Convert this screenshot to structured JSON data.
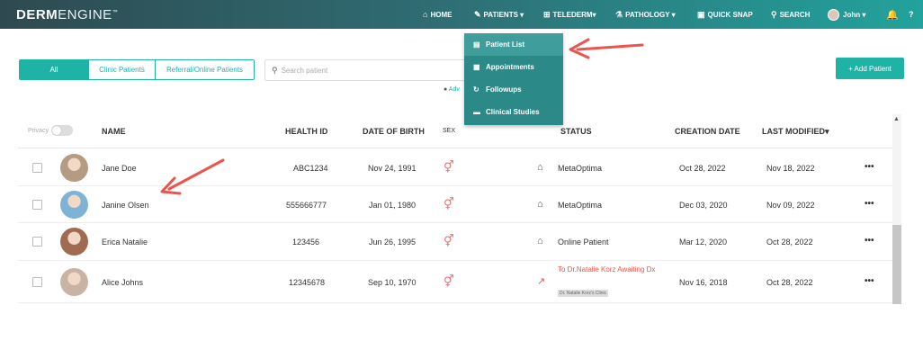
{
  "app": {
    "logo_bold": "DERM",
    "logo_light": "ENGINE",
    "logo_mark": "™"
  },
  "nav": {
    "home": "HOME",
    "patients": "PATIENTS ▾",
    "telederm": "TELEDERM▾",
    "pathology": "PATHOLOGY ▾",
    "quick_snap": "QUICK SNAP",
    "search": "SEARCH",
    "user": "John ▾"
  },
  "patients_menu": {
    "items": [
      "Patient List",
      "Appointments",
      "Followups",
      "Clinical Studies"
    ],
    "active": "Patient List"
  },
  "filters": {
    "segments": [
      "All",
      "Clinic Patients",
      "Referral/Online Patients"
    ],
    "selected": "All"
  },
  "search": {
    "placeholder": "Search patient",
    "advanced_label": "Adv"
  },
  "actions": {
    "add_patient": "+ Add Patient"
  },
  "table": {
    "privacy_label": "Privacy",
    "headers": {
      "name": "NAME",
      "health_id": "HEALTH ID",
      "dob": "DATE OF BIRTH",
      "sex": "SEX",
      "status": "STATUS",
      "creation_date": "CREATION DATE",
      "last_modified": "LAST MODIFIED▾"
    },
    "rows": [
      {
        "name": "Jane Doe",
        "health_id": "ABC1234",
        "dob": "Nov 24, 1991",
        "status": "MetaOptima",
        "status_type": "clinic",
        "created": "Oct 28, 2022",
        "modified": "Nov 18, 2022",
        "avatar_color": "#b59a84",
        "more": "•••"
      },
      {
        "name": "Janine Olsen",
        "health_id": "555666777",
        "dob": "Jan 01, 1980",
        "status": "MetaOptima",
        "status_type": "clinic",
        "created": "Dec 03, 2020",
        "modified": "Nov 09, 2022",
        "avatar_color": "#7fb3d6",
        "more": "•••"
      },
      {
        "name": "Erica Natalie",
        "health_id": "123456",
        "dob": "Jun 26, 1995",
        "status": "Online Patient",
        "status_type": "clinic",
        "created": "Mar 12, 2020",
        "modified": "Oct 28, 2022",
        "avatar_color": "#a06b52",
        "more": "•••"
      },
      {
        "name": "Alice Johns",
        "health_id": "12345678",
        "dob": "Sep 10, 1970",
        "status": "To Dr.Natalie Korz Awaiting Dx",
        "status_type": "referral",
        "clinic_tag": "Dr. Natalie Korz's Clinic",
        "created": "Nov 16, 2018",
        "modified": "Oct 28, 2022",
        "avatar_color": "#c9b3a4",
        "more": "•••"
      }
    ]
  },
  "colors": {
    "accent": "#1fb3a6",
    "annotation": "#e9564e",
    "menu_bg": "#2b8a88"
  }
}
